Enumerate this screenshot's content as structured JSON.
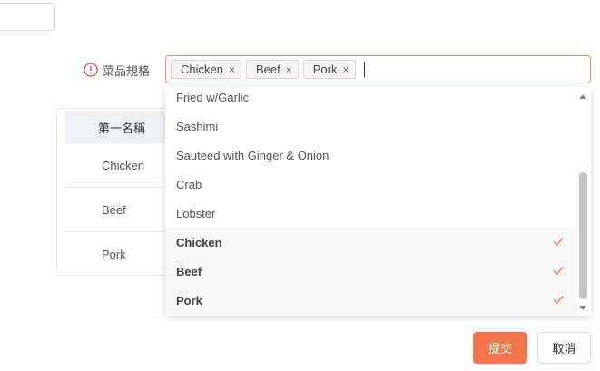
{
  "form": {
    "label": "菜品規格",
    "tags": [
      "Chicken",
      "Beef",
      "Pork"
    ],
    "tag_close_symbol": "×"
  },
  "spec_table": {
    "header": "第一名稱",
    "rows": [
      "Chicken",
      "Beef",
      "Pork"
    ]
  },
  "dropdown": {
    "options": [
      {
        "label": "Fried w/Garlic",
        "selected": false
      },
      {
        "label": "Sashimi",
        "selected": false
      },
      {
        "label": "Sauteed with Ginger & Onion",
        "selected": false
      },
      {
        "label": "Crab",
        "selected": false
      },
      {
        "label": "Lobster",
        "selected": false
      },
      {
        "label": "Chicken",
        "selected": true
      },
      {
        "label": "Beef",
        "selected": true
      },
      {
        "label": "Pork",
        "selected": true
      }
    ]
  },
  "buttons": {
    "submit": "提交",
    "cancel": "取消"
  },
  "colors": {
    "accent": "#f2764a",
    "warning": "#e84a4a",
    "selected_bg": "#f7f7f7"
  }
}
